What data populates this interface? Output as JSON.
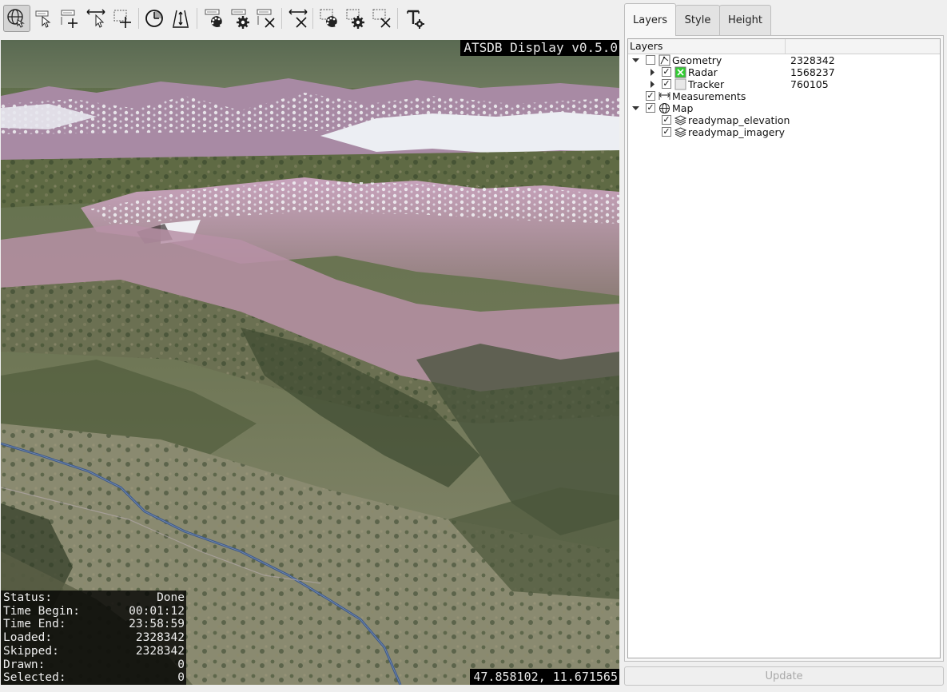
{
  "toolbar": {
    "buttons": [
      {
        "name": "navigate-globe-button",
        "icon": "globe-hand-icon",
        "active": true
      },
      {
        "name": "label-edit-button",
        "icon": "label-pointer-icon"
      },
      {
        "name": "label-add-button",
        "icon": "label-add-icon"
      },
      {
        "name": "measure-select-button",
        "icon": "measure-pointer-icon"
      },
      {
        "name": "rect-add-button",
        "icon": "rect-plus-icon"
      },
      {
        "name": "time-filter-button",
        "icon": "clock-icon"
      },
      {
        "name": "altitude-filter-button",
        "icon": "altitude-icon"
      },
      {
        "name": "style-palette-button",
        "icon": "palette-icon"
      },
      {
        "name": "style-settings-button",
        "icon": "gear-icon"
      },
      {
        "name": "style-remove-button",
        "icon": "label-remove-icon"
      },
      {
        "name": "measure-remove-button",
        "icon": "measure-remove-icon"
      },
      {
        "name": "selection-color-button",
        "icon": "select-palette-icon"
      },
      {
        "name": "selection-settings-button",
        "icon": "select-gear-icon"
      },
      {
        "name": "selection-clear-button",
        "icon": "select-remove-icon"
      },
      {
        "name": "text-tool-button",
        "icon": "text-gear-icon"
      }
    ]
  },
  "viewport": {
    "title": "ATSDB Display v0.5.0",
    "coordinates": "47.858102, 11.671565",
    "status": [
      {
        "label": "Status:",
        "value": "Done"
      },
      {
        "label": "Time Begin:",
        "value": "00:01:12"
      },
      {
        "label": "Time End:",
        "value": "23:58:59"
      },
      {
        "label": "Loaded:",
        "value": "2328342"
      },
      {
        "label": "Skipped:",
        "value": "2328342"
      },
      {
        "label": "Drawn:",
        "value": "0"
      },
      {
        "label": "Selected:",
        "value": "0"
      }
    ]
  },
  "dock": {
    "tabs": [
      {
        "label": "Layers",
        "active": true
      },
      {
        "label": "Style",
        "active": false
      },
      {
        "label": "Height",
        "active": false
      }
    ],
    "tree": {
      "header": "Layers",
      "rows": [
        {
          "label": "Geometry",
          "count": "2328342",
          "expander": "open",
          "checked": false,
          "icon": "geometry-icon"
        },
        {
          "label": "Radar",
          "count": "1568237",
          "expander": "closed",
          "checked": true,
          "icon": "radar-color-icon"
        },
        {
          "label": "Tracker",
          "count": "760105",
          "expander": "closed",
          "checked": true,
          "icon": "tracker-color-icon"
        },
        {
          "label": "Measurements",
          "count": "",
          "expander": "none",
          "checked": true,
          "icon": "measure-icon"
        },
        {
          "label": "Map",
          "count": "",
          "expander": "open",
          "checked": true,
          "icon": "globe-icon"
        },
        {
          "label": "readymap_elevation",
          "count": "",
          "expander": "none",
          "checked": true,
          "icon": "layers-icon"
        },
        {
          "label": "readymap_imagery",
          "count": "",
          "expander": "none",
          "checked": true,
          "icon": "layers-icon"
        }
      ]
    },
    "update_label": "Update"
  },
  "colors": {
    "radar_swatch": "#33cc33",
    "tracker_swatch": "#e8e8e8",
    "river": "#3f5a8a",
    "snow": "#eef0f4",
    "rock": "#b78ea8"
  }
}
